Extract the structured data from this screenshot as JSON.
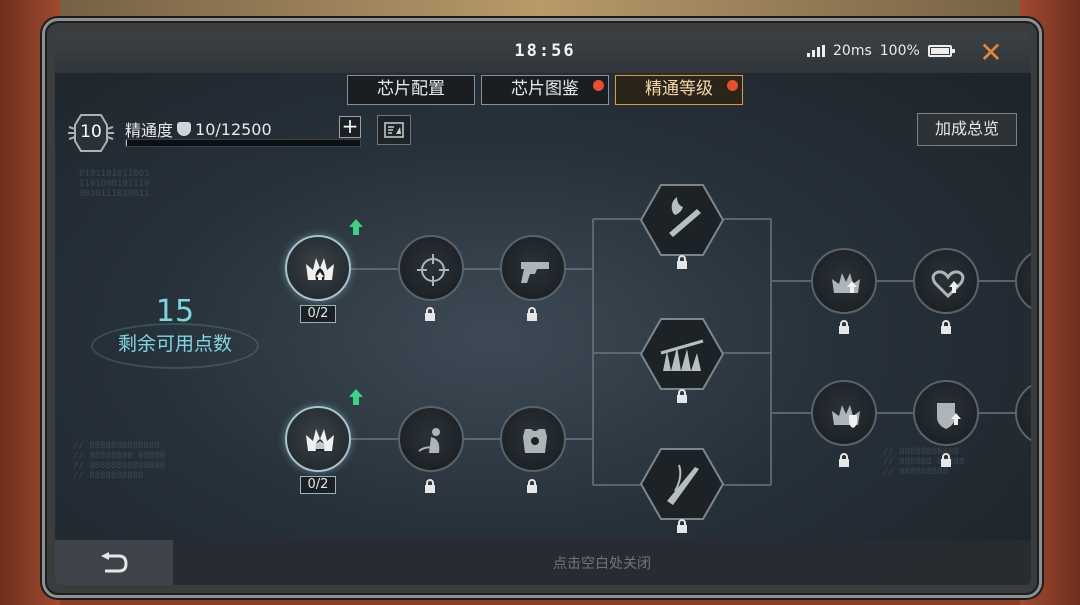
{
  "status_bar": {
    "time": "18:56",
    "ping": "20ms",
    "battery": "100%"
  },
  "tabs": [
    {
      "label": "芯片配置",
      "active": false,
      "badge": false
    },
    {
      "label": "芯片图鉴",
      "active": false,
      "badge": true
    },
    {
      "label": "精通等级",
      "active": true,
      "badge": true
    }
  ],
  "mastery": {
    "level": "10",
    "label": "精通度",
    "progress_text": "10/12500",
    "progress_fraction": 0.0008
  },
  "overview_label": "加成总览",
  "points": {
    "value": "15",
    "label": "剩余可用点数"
  },
  "tree": {
    "row1_start": {
      "count": "0/2",
      "icon": "flame-crown-icon"
    },
    "row2_start": {
      "count": "0/2",
      "icon": "flame-crown-icon"
    },
    "nodes": [
      {
        "name": "crosshair-icon",
        "locked": true
      },
      {
        "name": "pistol-icon",
        "locked": true
      },
      {
        "name": "dagger-slash-icon",
        "locked": true
      },
      {
        "name": "armor-vest-icon",
        "locked": true
      },
      {
        "name": "fire-sword-icon",
        "locked": true
      },
      {
        "name": "grass-blade-icon",
        "locked": true
      },
      {
        "name": "blade-icon",
        "locked": true
      },
      {
        "name": "flame-up-icon",
        "locked": true
      },
      {
        "name": "heart-up-icon",
        "locked": true
      },
      {
        "name": "flame-shield-icon",
        "locked": true
      },
      {
        "name": "shield-up-icon",
        "locked": true
      }
    ]
  },
  "bottom_hint": "点击空白处关闭",
  "colors": {
    "accent_orange": "#e19a3b",
    "points_cyan": "#7fd6e0",
    "badge_red": "#e64f2f"
  }
}
